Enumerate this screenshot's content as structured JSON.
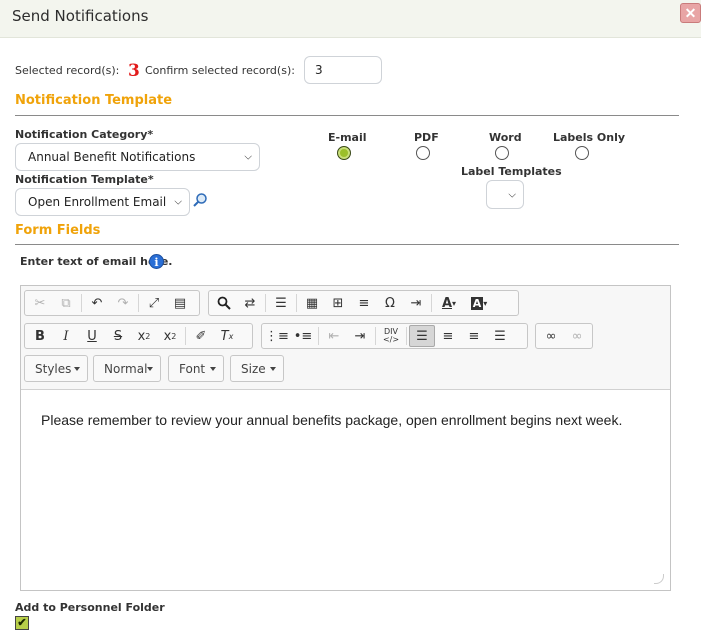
{
  "dialog": {
    "title": "Send Notifications",
    "close_label": "✕"
  },
  "selection": {
    "selected_label": "Selected record(s):",
    "selected_count": "3",
    "confirm_label": "Confirm selected record(s):",
    "confirm_value": "3"
  },
  "template_section": {
    "heading": "Notification Template",
    "category_label": "Notification Category*",
    "category_value": "Annual Benefit Notifications",
    "template_label": "Notification Template*",
    "template_value": "Open Enrollment Email",
    "formats": [
      {
        "label": "E-mail",
        "selected": true
      },
      {
        "label": "PDF",
        "selected": false
      },
      {
        "label": "Word",
        "selected": false
      },
      {
        "label": "Labels Only",
        "selected": false
      }
    ],
    "label_templates_label": "Label Templates",
    "label_templates_value": ""
  },
  "form_fields": {
    "heading": "Form Fields",
    "email_prompt": "Enter text of email here.",
    "info_icon": "i"
  },
  "editor": {
    "toolbar_icons": [
      "cut-icon",
      "copy-icon",
      "undo-icon",
      "redo-icon",
      "maximize-icon",
      "source-icon",
      "find-icon",
      "replace-icon",
      "select-all-icon",
      "image-icon",
      "table-icon",
      "horizontal-line-icon",
      "special-char-icon",
      "page-break-icon",
      "text-color-icon",
      "background-color-icon",
      "bold-icon",
      "italic-icon",
      "underline-icon",
      "strikethrough-icon",
      "subscript-icon",
      "superscript-icon",
      "copy-format-icon",
      "remove-format-icon",
      "numbered-list-icon",
      "bulleted-list-icon",
      "outdent-icon",
      "indent-icon",
      "div-icon",
      "align-left-icon",
      "align-center-icon",
      "align-right-icon",
      "justify-icon",
      "link-icon",
      "unlink-icon"
    ],
    "styles_label": "Styles",
    "format_label": "Normal",
    "font_label": "Font",
    "size_label": "Size",
    "body_text": "Please remember to review your annual benefits package, open enrollment begins next week."
  },
  "personnel": {
    "label": "Add to Personnel Folder",
    "checked": true
  },
  "colors": {
    "accent": "#f0a30a",
    "count": "#e21b1b",
    "radio_selected": "#9bbf2a"
  }
}
